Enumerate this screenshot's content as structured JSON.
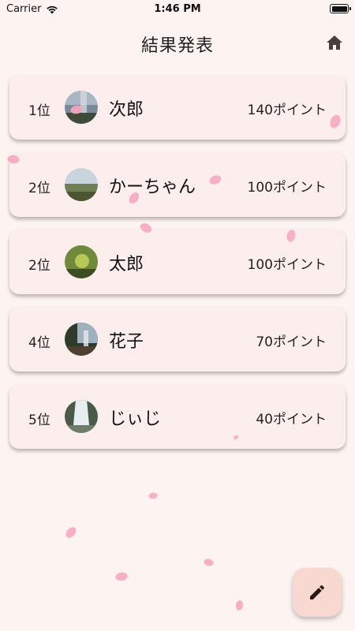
{
  "status_bar": {
    "carrier": "Carrier",
    "time": "1:46 PM"
  },
  "header": {
    "title": "結果発表",
    "home_icon": "home-icon"
  },
  "results": [
    {
      "rank": "1位",
      "name": "次郎",
      "points": "140ポイント",
      "avatar_colors": [
        "#6c7a8a",
        "#a9b7c6",
        "#3d4a36"
      ]
    },
    {
      "rank": "2位",
      "name": "かーちゃん",
      "points": "100ポイント",
      "avatar_colors": [
        "#c9d4dc",
        "#8a9b73",
        "#4f5e3a"
      ]
    },
    {
      "rank": "2位",
      "name": "太郎",
      "points": "100ポイント",
      "avatar_colors": [
        "#6f8a3a",
        "#a9c04c",
        "#3e4e22"
      ]
    },
    {
      "rank": "4位",
      "name": "花子",
      "points": "70ポイント",
      "avatar_colors": [
        "#2f3a2a",
        "#8fa3b0",
        "#5b4a36"
      ]
    },
    {
      "rank": "5位",
      "name": "じぃじ",
      "points": "40ポイント",
      "avatar_colors": [
        "#4a5a4a",
        "#e8eef0",
        "#6e7d6a"
      ]
    }
  ],
  "fab": {
    "icon": "pencil-icon"
  },
  "colors": {
    "background": "#fdf3f1",
    "card": "#fbeeec",
    "petal": "#f7a6c0",
    "fab": "#f8d9d2"
  }
}
